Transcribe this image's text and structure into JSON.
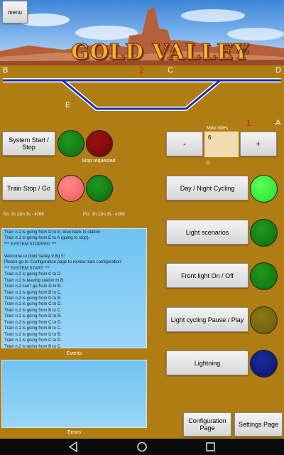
{
  "app": {
    "title": "GOLD VALLEY",
    "version": "V.8g",
    "menu_label": "menu"
  },
  "track": {
    "labels": {
      "b": "B",
      "c": "C",
      "d": "D",
      "e": "E",
      "a": "A"
    },
    "active_count": "2",
    "line_color": "#1a2fb0"
  },
  "system": {
    "start_stop_label": "System Start / Stop",
    "status_text": "Stop requested",
    "lamp_green": "#137a13",
    "lamp_red": "#7a0a0a"
  },
  "train": {
    "start_stop_label": "Train Stop / Go",
    "lamp_red": "#ff6f6f",
    "lamp_green": "#137a13"
  },
  "stats": {
    "total": "Tot. 1h 11m 3s - #208",
    "partial": "Prz. 1h 11m 3s - #208"
  },
  "max_rides": {
    "label": "Max rides",
    "value": "6",
    "count_below": "0",
    "counter_above": "1",
    "minus_label": "-",
    "plus_label": "+"
  },
  "controls": [
    {
      "label": "Day / Night Cycling",
      "lamp": "#2cf52c"
    },
    {
      "label": "Light scenarios",
      "lamp": "#137a13"
    },
    {
      "label": "Front light On / Off",
      "lamp": "#137a13"
    },
    {
      "label": "Light cycling Pause / Play",
      "lamp": "#7a6a0a"
    },
    {
      "label": "Lightning",
      "lamp": "#0a1a7a"
    }
  ],
  "events": {
    "caption": "Events",
    "lines": [
      "Train n.1 is going from D to E, then back to station.",
      "Train n.1 is going from E to A (going to stop).",
      "*** SYSTEM STOPPED ***",
      "",
      "Welcome to Gold Valley V.8g !!!",
      "Please go to 'Configuration page to review train configuration'",
      "*** SYSTEM START ***",
      "Train n.2 is going from C to D.",
      "Train n.1 is leaving station to B.",
      "Train n.2 can't go from D to B.",
      "Train n.1 is going from B to C.",
      "Train n.2 is going from D to B.",
      "Train n.1 is going from C to D.",
      "Train n.2 is going from B to C.",
      "Train n.1 is going from D to B.",
      "Train n.2 is going from C to D.",
      "Train n.1 is going from B to C.",
      "Train n.2 is going from D to B.",
      "Train n.1 is going from C to D.",
      "Train n.2 is going from B to C.",
      "Train n.1 is going from D to B.",
      "Train n.2 is going from C to D.",
      "STOP REQUEST ACCEPTED.",
      "Train n.1 is going from C to D."
    ]
  },
  "errors": {
    "caption": "Errors"
  },
  "footer": {
    "configuration_label": "Configuration Page",
    "settings_label": "Settings Page"
  },
  "navbar": {
    "icons": [
      "back-icon",
      "home-icon",
      "recents-icon"
    ]
  }
}
